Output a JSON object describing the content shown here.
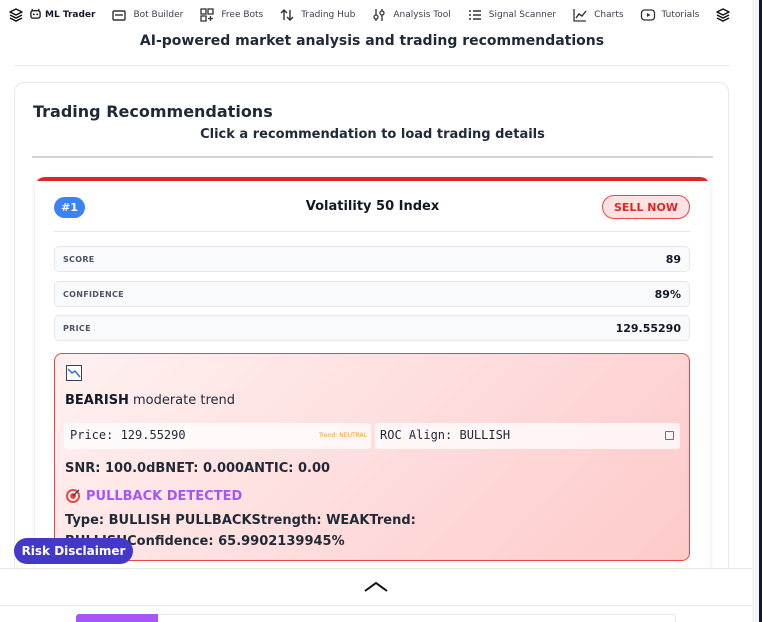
{
  "nav": {
    "items": [
      {
        "label": "ML Trader",
        "icon": "layers-icon",
        "active": true
      },
      {
        "label": "Bot Builder",
        "icon": "bot-icon"
      },
      {
        "label": "Free Bots",
        "icon": "grid-plus-icon"
      },
      {
        "label": "Trading Hub",
        "icon": "arrows-icon"
      },
      {
        "label": "Analysis Tool",
        "icon": "sliders-icon"
      },
      {
        "label": "Signal Scanner",
        "icon": "list-icon"
      },
      {
        "label": "Charts",
        "icon": "chart-icon"
      },
      {
        "label": "Tutorials",
        "icon": "play-icon"
      }
    ]
  },
  "header": {
    "subtitle": "AI-powered market analysis and trading recommendations"
  },
  "recommendations": {
    "title": "Trading Recommendations",
    "subtitle": "Click a recommendation to load trading details",
    "card": {
      "rank": "#1",
      "symbol": "Volatility 50 Index",
      "action": "SELL NOW",
      "metrics": [
        {
          "label": "SCORE",
          "value": "89"
        },
        {
          "label": "CONFIDENCE",
          "value": "89%"
        },
        {
          "label": "PRICE",
          "value": "129.55290"
        }
      ],
      "trend": {
        "direction": "BEARISH",
        "description": "moderate trend",
        "price_text": "Price: 129.55290",
        "trend_tag": "Trend: NEUTRAL",
        "roc_text": "ROC Align: BULLISH",
        "snr_text": "SNR: 100.0dBNET: 0.000ANTIC: 0.00",
        "pullback_label": "PULLBACK DETECTED",
        "pullback_details": "Type: BULLISH PULLBACKStrength: WEAKTrend: BULLISHConfidence: 65.9902139945%"
      }
    }
  },
  "risk_disclaimer": "Risk Disclaimer",
  "colors": {
    "sell": "#dc2626",
    "rank": "#3b82f6",
    "pullback": "#a855f7",
    "risk": "#4338ca"
  }
}
